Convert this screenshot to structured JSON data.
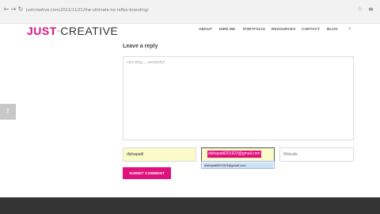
{
  "browser": {
    "back_icon": "arrow-left-icon",
    "forward_icon": "arrow-right-icon",
    "reload_icon": "reload-icon",
    "url": "justcreative.com/2011/11/21/the-ultimate-no-reflex-branding/",
    "star_icon": "star-icon",
    "menu_icon": "menu-icon"
  },
  "header": {
    "logo_just": "JUST",
    "logo_tm": "™",
    "logo_creative": "CREATIVE",
    "menu": [
      "ABOUT",
      "HIRE ME",
      "PORTFOLIO",
      "RESOURCES",
      "CONTACT",
      "BLOG"
    ],
    "search_icon": "search-icon"
  },
  "comment_form": {
    "title": "Leave a reply",
    "comment_value": "nice blog.....swwtwfwt",
    "name_value": "dishapatil",
    "email_value": "dishapatil201923@gmail.com",
    "website_placeholder": "Website",
    "autofill_suggestion": "dishapatil201923@gmail.com",
    "submit_label": "SUBMIT COMMENT"
  },
  "sidebar": {
    "share_icon": "facebook-icon",
    "share_glyph": "f"
  },
  "colors": {
    "brand": "#e0127d",
    "autofill": "#fbfbc9",
    "footer": "#333333"
  }
}
